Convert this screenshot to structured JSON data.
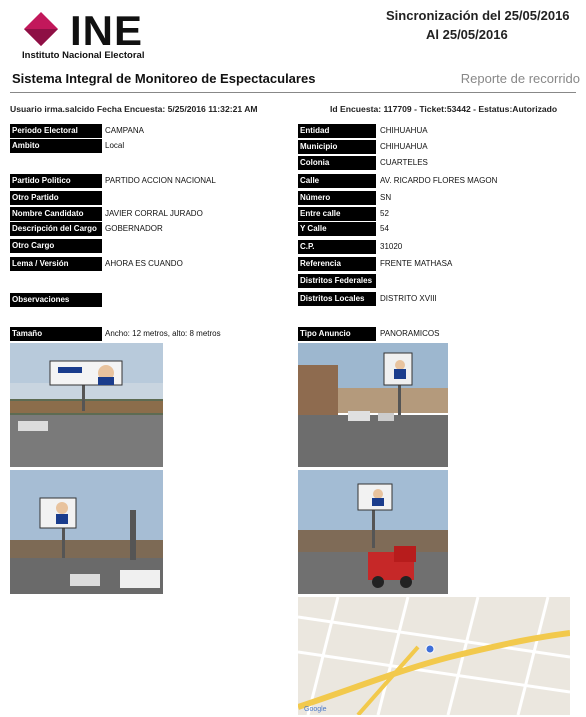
{
  "header": {
    "logo_text": "INE",
    "logo_sub": "Instituto Nacional Electoral",
    "sync_line": "Sincronización del 25/05/2016",
    "sync_to": "Al 25/05/2016",
    "system_title": "Sistema Integral de Monitoreo de Espectaculares",
    "report_type": "Reporte de recorrido"
  },
  "info": {
    "left": "Usuario irma.salcido Fecha Encuesta: 5/25/2016 11:32:21 AM",
    "right": "Id Encuesta: 117709 - Ticket:53442 - Estatus:Autorizado"
  },
  "fields_left": [
    {
      "label": "Periodo Electoral",
      "value": "CAMPANA"
    },
    {
      "label": "Ambito",
      "value": "Local"
    },
    {
      "label": "Partido Politico",
      "value": "PARTIDO ACCION NACIONAL"
    },
    {
      "label": "Otro Partido",
      "value": ""
    },
    {
      "label": "Nombre Candidato",
      "value": "JAVIER CORRAL JURADO"
    },
    {
      "label": "Descripción del Cargo",
      "value": "GOBERNADOR"
    },
    {
      "label": "Otro Cargo",
      "value": ""
    },
    {
      "label": "Lema / Versión",
      "value": "AHORA ES CUANDO"
    },
    {
      "label": "Observaciones",
      "value": ""
    },
    {
      "label": "Tamaño",
      "value": "Ancho: 12 metros, alto: 8 metros"
    }
  ],
  "fields_right": [
    {
      "label": "Entidad",
      "value": "CHIHUAHUA"
    },
    {
      "label": "Municipio",
      "value": "CHIHUAHUA"
    },
    {
      "label": "Colonia",
      "value": "CUARTELES"
    },
    {
      "label": "Calle",
      "value": "AV. RICARDO FLORES MAGON"
    },
    {
      "label": "Número",
      "value": "SN"
    },
    {
      "label": "Entre calle",
      "value": "52"
    },
    {
      "label": "Y Calle",
      "value": "54"
    },
    {
      "label": "C.P.",
      "value": "31020"
    },
    {
      "label": "Referencia",
      "value": "FRENTE MATHASA"
    },
    {
      "label": "Distritos Federales",
      "value": ""
    },
    {
      "label": "Distritos Locales",
      "value": "DISTRITO XVIII"
    },
    {
      "label": "Tipo Anuncio",
      "value": "PANORAMICOS"
    }
  ],
  "colors": {
    "label_bg": "#000000",
    "logo_pink": "#c2185b",
    "sky": "#9fb8d3",
    "road": "#6d6d6d",
    "truck": "#c62828",
    "map_bg": "#e9e6df",
    "map_road": "#f2c94c"
  },
  "photos": [
    {
      "name": "photo-billboard-front"
    },
    {
      "name": "photo-billboard-street"
    },
    {
      "name": "photo-billboard-closeup"
    },
    {
      "name": "photo-billboard-truck"
    }
  ],
  "map": {
    "name": "location-map"
  }
}
